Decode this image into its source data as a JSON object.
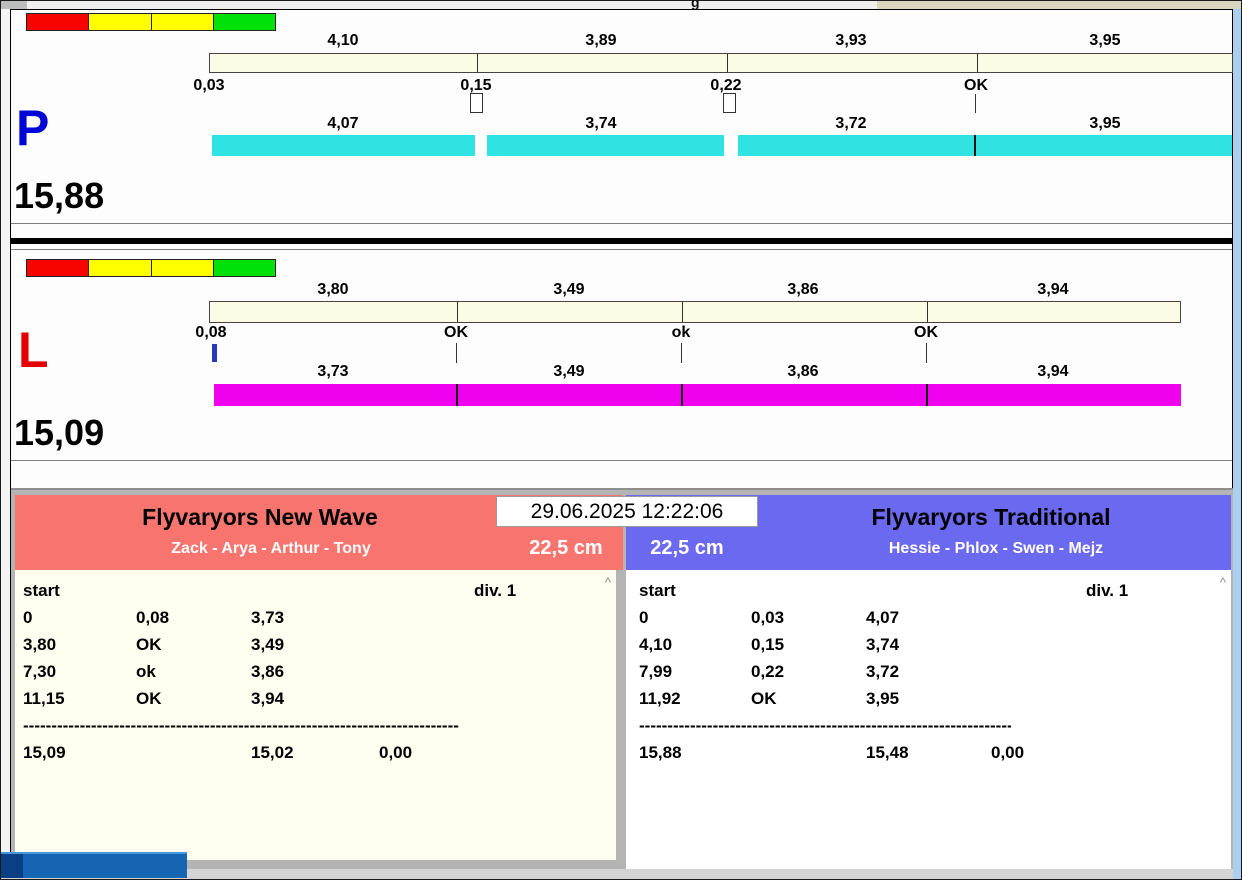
{
  "window": {
    "datetime": "29.06.2025 12:22:06",
    "top_fragment": "g"
  },
  "ui": {
    "scroll_up_glyph": "^"
  },
  "colors": {
    "cyan_bar": "#2fe3e3",
    "magenta_bar": "#ef00ef",
    "cream_bar": "#fbfbe6",
    "left_header": "#f8756f",
    "right_header": "#6a69ef",
    "p_letter": "#0004d6",
    "l_letter": "#e40000",
    "light_red": "#f80400",
    "light_yellow": "#ffff00",
    "light_green": "#00e109"
  },
  "lanes": [
    {
      "letter": "P",
      "total": "15,88",
      "top_segments": [
        "4,10",
        "3,89",
        "3,93",
        "3,95"
      ],
      "splits": [
        "0,03",
        "0,15",
        "0,22",
        "OK"
      ],
      "bottom_segments": [
        "4,07",
        "3,74",
        "3,72",
        "3,95"
      ]
    },
    {
      "letter": "L",
      "total": "15,09",
      "top_segments": [
        "3,80",
        "3,49",
        "3,86",
        "3,94"
      ],
      "splits": [
        "0,08",
        "OK",
        "ok",
        "OK"
      ],
      "bottom_segments": [
        "3,73",
        "3,49",
        "3,86",
        "3,94"
      ]
    }
  ],
  "teams": [
    {
      "name": "Flyvaryors New Wave",
      "members": "Zack - Arya - Arthur - Tony",
      "size": "22,5 cm",
      "start_label": "start",
      "div_label": "div. 1",
      "rows": [
        {
          "c1": "0",
          "c2": "0,08",
          "c3": "3,73"
        },
        {
          "c1": "3,80",
          "c2": "OK",
          "c3": "3,49"
        },
        {
          "c1": "7,30",
          "c2": "ok",
          "c3": "3,86"
        },
        {
          "c1": "11,15",
          "c2": "OK",
          "c3": "3,94"
        }
      ],
      "separator": "--------------------------------------------------------------------------------",
      "total_row": {
        "c1": "15,09",
        "c3": "15,02",
        "c4": "0,00"
      }
    },
    {
      "name": "Flyvaryors Traditional",
      "members": "Hessie - Phlox - Swen - Mejz",
      "size": "22,5 cm",
      "start_label": "start",
      "div_label": "div. 1",
      "rows": [
        {
          "c1": "0",
          "c2": "0,03",
          "c3": "4,07"
        },
        {
          "c1": "4,10",
          "c2": "0,15",
          "c3": "3,74"
        },
        {
          "c1": "7,99",
          "c2": "0,22",
          "c3": "3,72"
        },
        {
          "c1": "11,92",
          "c2": "OK",
          "c3": "3,95"
        }
      ],
      "separator": "--------------------------------------------------------------------------------",
      "total_row": {
        "c1": "15,88",
        "c3": "15,48",
        "c4": "0,00"
      }
    }
  ]
}
